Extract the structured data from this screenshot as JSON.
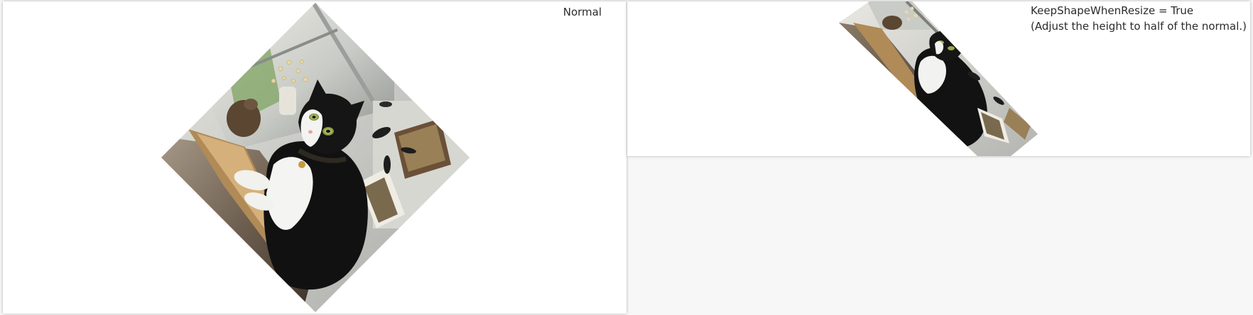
{
  "panels": {
    "normal": {
      "caption": "Normal",
      "image": {
        "subject": "tuxedo cat by a window",
        "shape": "diamond"
      }
    },
    "keep_shape": {
      "caption": "KeepShapeWhenResize = True\n(Adjust the height to half of the normal.)",
      "image": {
        "subject": "tuxedo cat by a window",
        "shape": "skewed-diamond"
      }
    }
  },
  "colors": {
    "background": "#f7f7f7",
    "panel": "#ffffff",
    "caption_text": "#2b2b2b"
  }
}
